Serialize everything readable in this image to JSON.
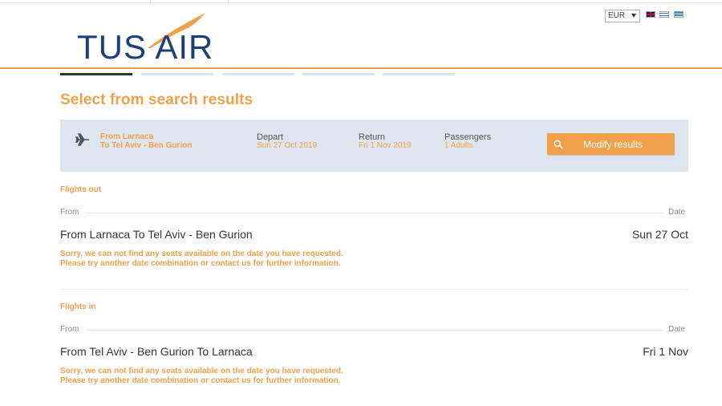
{
  "brand": {
    "name": "TUS AIR",
    "colors": {
      "navy": "#1d3f74",
      "orange": "#f0a04b",
      "summary_bg": "#dfe5ec"
    }
  },
  "header": {
    "currency": "EUR",
    "flags": [
      "uk-flag-icon",
      "israel-flag-icon",
      "greece-flag-icon"
    ]
  },
  "page_title": "Select from search results",
  "summary": {
    "route_from": "From Larnaca",
    "route_to": "To Tel Aviv - Ben Gurion",
    "depart_label": "Depart",
    "depart_value": "Sun 27 Oct 2019",
    "return_label": "Return",
    "return_value": "Fri 1 Nov 2019",
    "passengers_label": "Passengers",
    "passengers_value": "1 Adults",
    "modify_label": "Modify results"
  },
  "flights_out": {
    "title": "Flights out",
    "col_from": "From",
    "col_date": "Date",
    "route": "From Larnaca To Tel Aviv - Ben Gurion",
    "date": "Sun 27 Oct",
    "message_line1": "Sorry, we can not find any seats available on the date you have requested.",
    "message_line2": "Please try another date combination or contact us for further information."
  },
  "flights_in": {
    "title": "Flights in",
    "col_from": "From",
    "col_date": "Date",
    "route": "From Tel Aviv - Ben Gurion To Larnaca",
    "date": "Fri 1 Nov",
    "message_line1": "Sorry, we can not find any seats available on the date you have requested.",
    "message_line2": "Please try another date combination or contact us for further information."
  }
}
